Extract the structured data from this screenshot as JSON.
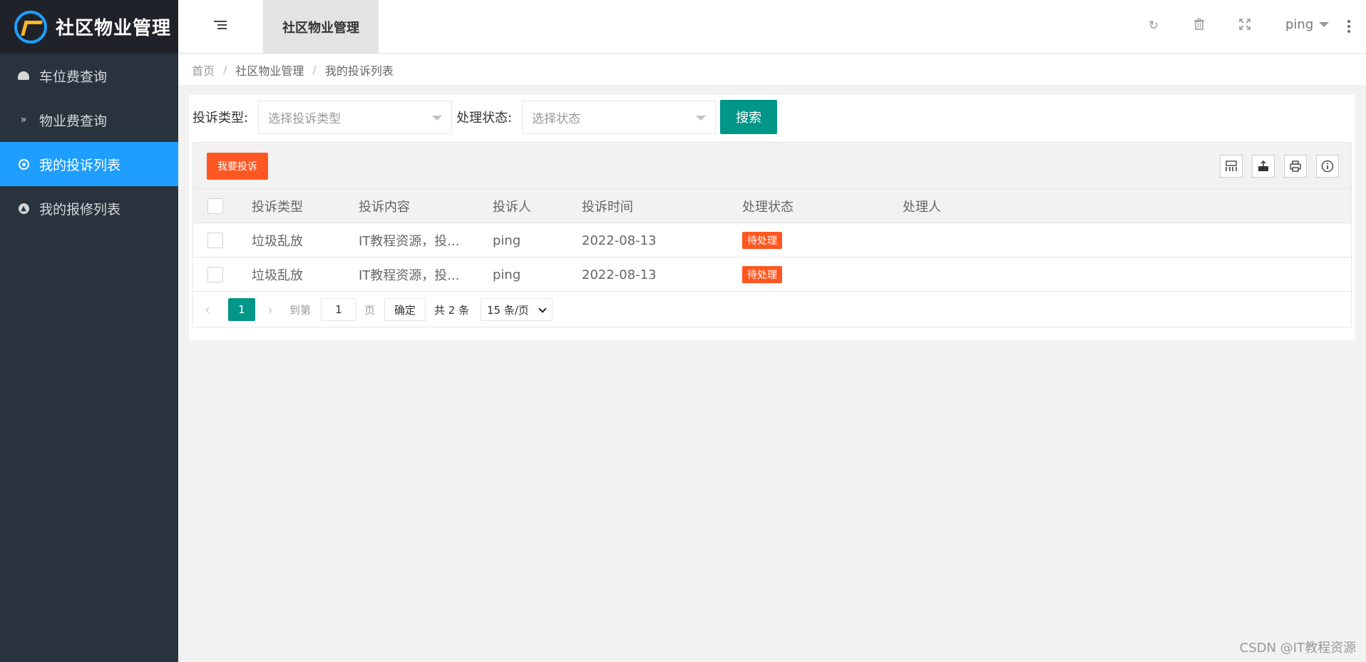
{
  "app": {
    "title": "社区物业管理"
  },
  "sidebar": {
    "items": [
      {
        "label": "车位费查询",
        "icon": "gauge-icon"
      },
      {
        "label": "物业费查询",
        "icon": "double-chevron-down-icon"
      },
      {
        "label": "我的投诉列表",
        "icon": "radio-dot-icon",
        "active": true
      },
      {
        "label": "我的报修列表",
        "icon": "circle-up-icon"
      }
    ]
  },
  "header": {
    "tab": "社区物业管理",
    "user": "ping"
  },
  "breadcrumb": {
    "items": [
      "首页",
      "社区物业管理",
      "我的投诉列表"
    ],
    "separator": "/"
  },
  "filters": {
    "type_label": "投诉类型:",
    "type_placeholder": "选择投诉类型",
    "status_label": "处理状态:",
    "status_placeholder": "选择状态",
    "search_button": "搜索"
  },
  "toolbar": {
    "complain_button": "我要投诉"
  },
  "table": {
    "columns": [
      "投诉类型",
      "投诉内容",
      "投诉人",
      "投诉时间",
      "处理状态",
      "处理人"
    ],
    "rows": [
      {
        "type": "垃圾乱放",
        "content": "IT教程资源，投...",
        "person": "ping",
        "time": "2022-08-13",
        "status": "待处理",
        "handler": ""
      },
      {
        "type": "垃圾乱放",
        "content": "IT教程资源，投...",
        "person": "ping",
        "time": "2022-08-13",
        "status": "待处理",
        "handler": ""
      }
    ]
  },
  "pager": {
    "current": "1",
    "goto_label": "到第",
    "goto_value": "1",
    "page_label": "页",
    "confirm": "确定",
    "total": "共 2 条",
    "page_size": "15 条/页"
  },
  "watermark": "CSDN @IT教程资源",
  "colors": {
    "sidebar_bg": "#28333e",
    "logo_bg": "#20222a",
    "active": "#1e9fff",
    "primary": "#009688",
    "danger": "#ff5722"
  }
}
